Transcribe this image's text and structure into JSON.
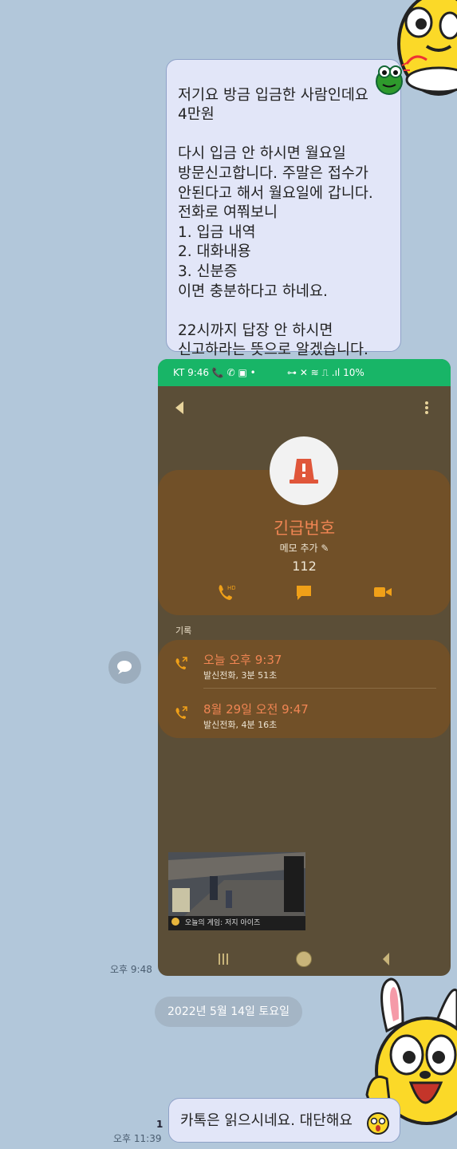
{
  "messages": {
    "msg1_text": "저기요 방금 입금한 사람인데요\n4만원\n\n다시 입금 안 하시면 월요일\n방문신고합니다. 주말은 접수가\n안된다고 해서 월요일에 갑니다.\n전화로 여쭤보니\n1. 입금 내역\n2. 대화내용\n3. 신분증\n이면 충분하다고 하네요.\n\n22시까지 답장 안 하시면\n신고하라는 뜻으로 알겠습니다.",
    "msg1_time": "오후 9:48",
    "date_divider": "2022년 5월 14일 토요일",
    "msg2_text": "카톡은 읽으시네요. 대단해요",
    "msg2_unread": "1",
    "msg2_time": "오후 11:39"
  },
  "screenshot": {
    "status": {
      "left": "KT 9:46 📞 ✆ ▣ •",
      "right": "⊶ ✕ ≋ ⎍ .ıl 10%"
    },
    "contact_name": "긴급번호",
    "memo_label": "메모 추가",
    "number": "112",
    "history_label": "기록",
    "history": [
      {
        "time": "오늘 오후 9:37",
        "detail": "발신전화, 3분 51초"
      },
      {
        "time": "8월 29일 오전 9:47",
        "detail": "발신전화, 4분 16초"
      }
    ],
    "pip_caption": "오늘의 게임: 저지 아이즈"
  },
  "colors": {
    "chat_bg": "#b2c7da",
    "bubble": "#e2e6f8",
    "status_green": "#18b567",
    "card_brown": "#715028",
    "accent_orange": "#f08553",
    "icon_orange": "#f0a018"
  }
}
